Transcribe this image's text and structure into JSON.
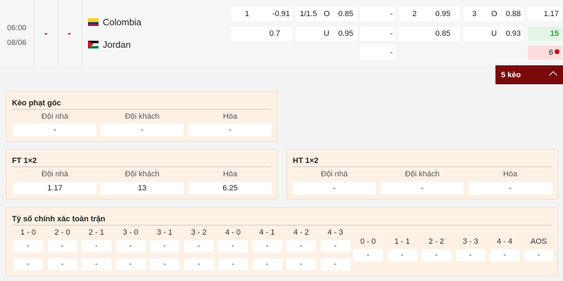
{
  "match": {
    "time": "06:00",
    "date": "08/06",
    "score_home": "-",
    "score_away": "-",
    "home_team": "Colombia",
    "away_team": "Jordan"
  },
  "odds": {
    "r1": {
      "hdp_label": "1",
      "hdp_home": "-0.91",
      "ou_line": "1/1.5",
      "ou_o": "O",
      "ou_over": "0.85",
      "c_a": "-",
      "c_b_label": "2",
      "c_b": "0.95",
      "c_c_label": "3",
      "c_c_o": "O",
      "c_c": "0.88",
      "c_d": "1.17"
    },
    "r2": {
      "hdp_away": "0.7",
      "ou_u": "U",
      "ou_under": "0.95",
      "c_a": "-",
      "c_b": "0.85",
      "c_c_u": "U",
      "c_c": "0.93",
      "c_d": "15"
    },
    "r3": {
      "c_a": "-",
      "c_d": "6"
    }
  },
  "collapse": {
    "label": "5 kèo"
  },
  "corner": {
    "title": "Kèo phạt góc",
    "headers": [
      "Đội nhà",
      "Đội khách",
      "Hòa"
    ],
    "values": [
      "-",
      "-",
      "-"
    ]
  },
  "ft": {
    "title": "FT 1×2",
    "headers": [
      "Đội nhà",
      "Đội khách",
      "Hòa"
    ],
    "values": [
      "1.17",
      "13",
      "6.25"
    ]
  },
  "ht": {
    "title": "HT 1×2",
    "headers": [
      "Đội nhà",
      "Đội khách",
      "Hòa"
    ],
    "values": [
      "-",
      "-",
      "-"
    ]
  },
  "correct_score": {
    "title": "Tỷ số chính xác toàn trận",
    "home_headers": [
      "1 - 0",
      "2 - 0",
      "2 - 1",
      "3 - 0",
      "3 - 1",
      "3 - 2",
      "4 - 0",
      "4 - 1",
      "4 - 2",
      "4 - 3"
    ],
    "draw_headers": [
      "0 - 0",
      "1 - 1",
      "2 - 2",
      "3 - 3",
      "4 - 4",
      "AOS"
    ],
    "placeholder": "-"
  },
  "colors": {
    "accent": "#7a0a0a",
    "green": "#2e9e3e",
    "red": "#d0021b",
    "panel": "#fdf1e6"
  }
}
